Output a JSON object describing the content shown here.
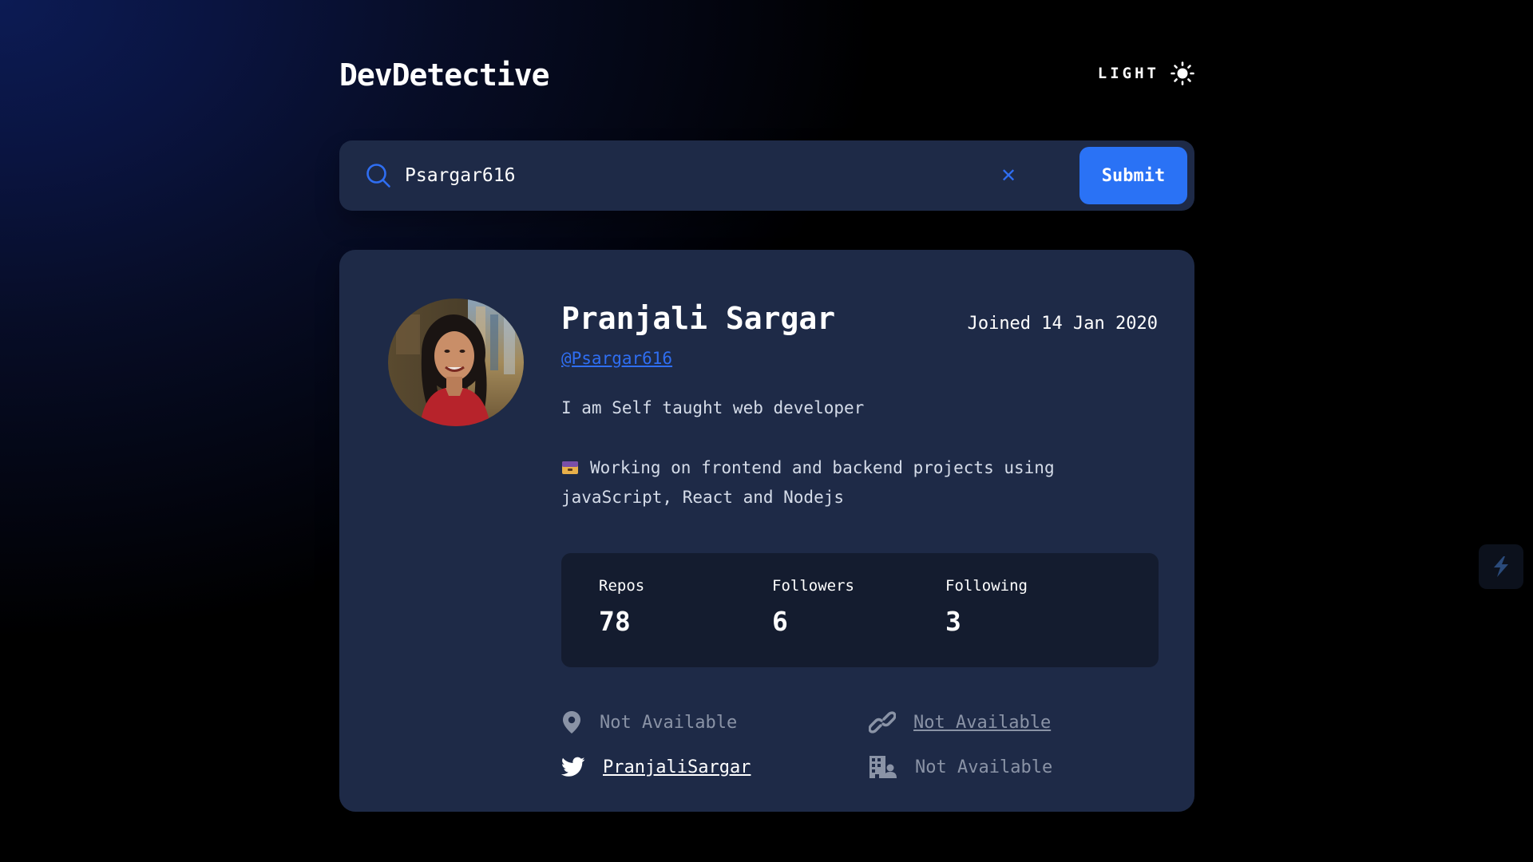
{
  "app": {
    "title": "DevDetective"
  },
  "theme_toggle": {
    "label": "LIGHT",
    "icon": "sun-icon"
  },
  "search": {
    "value": "Psargar616",
    "icon": "search-icon",
    "clear_icon": "close-icon",
    "clear_glyph": "✕",
    "submit_label": "Submit"
  },
  "profile": {
    "name": "Pranjali Sargar",
    "joined": "Joined 14 Jan 2020",
    "username": "@Psargar616",
    "bio_line1": "I am Self taught web developer",
    "bio_line2": "Working on frontend and backend projects using javaScript, React and Nodejs",
    "avatar": "avatar-photo"
  },
  "stats": [
    {
      "label": "Repos",
      "value": "78"
    },
    {
      "label": "Followers",
      "value": "6"
    },
    {
      "label": "Following",
      "value": "3"
    }
  ],
  "links": {
    "location": {
      "text": "Not Available",
      "icon": "location-pin-icon"
    },
    "website": {
      "text": "Not Available",
      "icon": "link-icon"
    },
    "twitter": {
      "text": "PranjaliSargar",
      "icon": "twitter-icon"
    },
    "company": {
      "text": "Not Available",
      "icon": "building-icon"
    }
  },
  "colors": {
    "accent": "#2a72f5",
    "card_bg": "#1e2a47",
    "stats_bg": "#141c2f",
    "muted_text": "#8a93a6"
  }
}
